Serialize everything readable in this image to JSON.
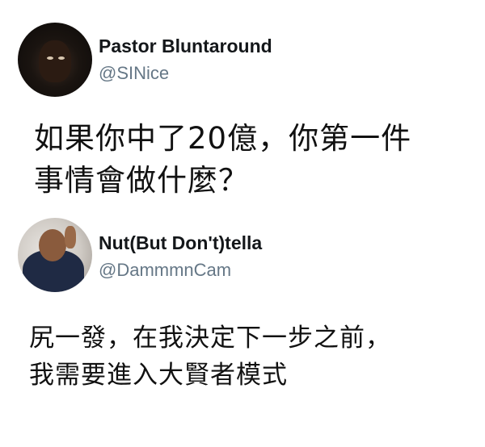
{
  "tweets": [
    {
      "display_name": "Pastor Bluntaround",
      "handle": "@SINice",
      "avatar": "profile-photo",
      "text": "如果你中了20億，你第一件\n事情會做什麼？"
    },
    {
      "display_name": "Nut(But Don't)tella",
      "handle": "@DammmnCam",
      "avatar": "profile-photo",
      "text": "尻一發，在我決定下一步之前，\n我需要進入大賢者模式"
    }
  ]
}
